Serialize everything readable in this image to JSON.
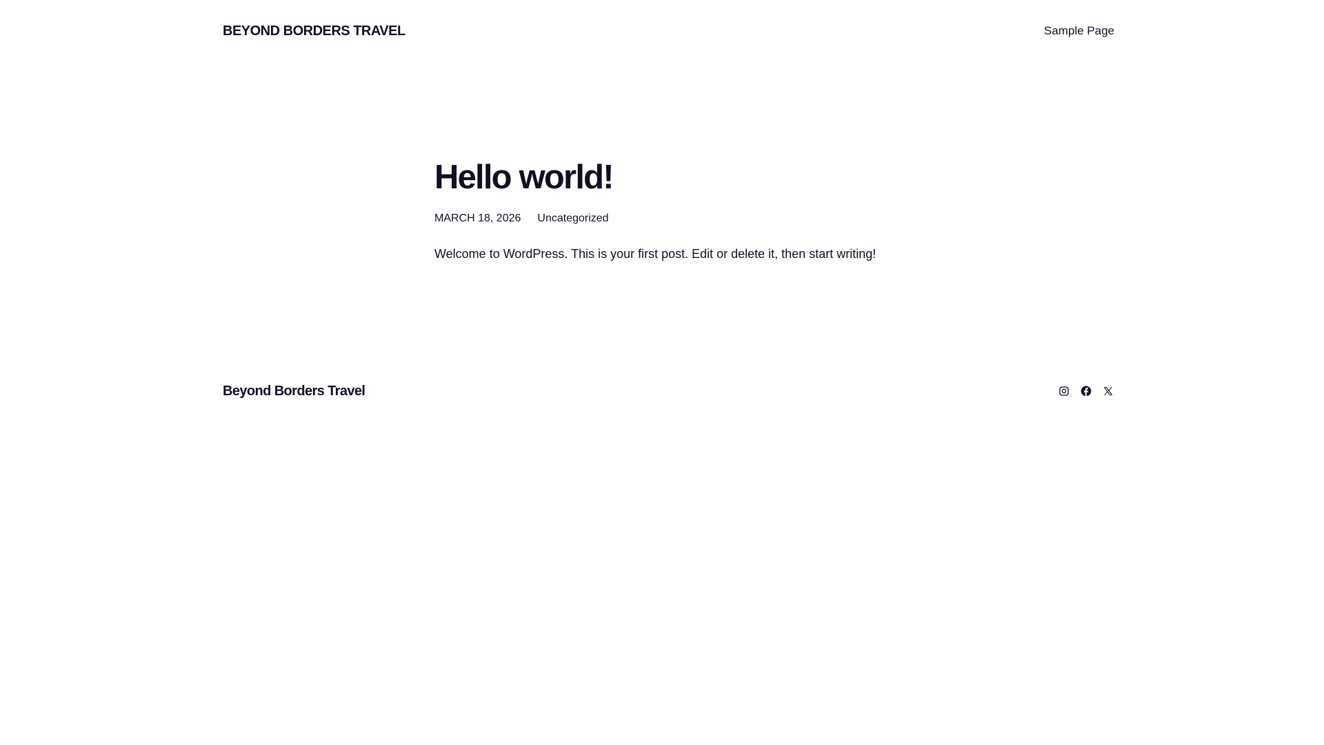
{
  "header": {
    "site_title": "BEYOND BORDERS TRAVEL",
    "nav": {
      "sample_page": "Sample Page"
    }
  },
  "post": {
    "title": "Hello world!",
    "date": "MARCH 18, 2026",
    "category": "Uncategorized",
    "content": "Welcome to WordPress. This is your first post. Edit or delete it, then start writing!"
  },
  "footer": {
    "site_title": "Beyond Borders Travel",
    "social": [
      {
        "icon": "instagram-icon"
      },
      {
        "icon": "facebook-icon"
      },
      {
        "icon": "x-icon"
      }
    ]
  },
  "colors": {
    "text": "#0f1024",
    "background": "#ffffff"
  }
}
